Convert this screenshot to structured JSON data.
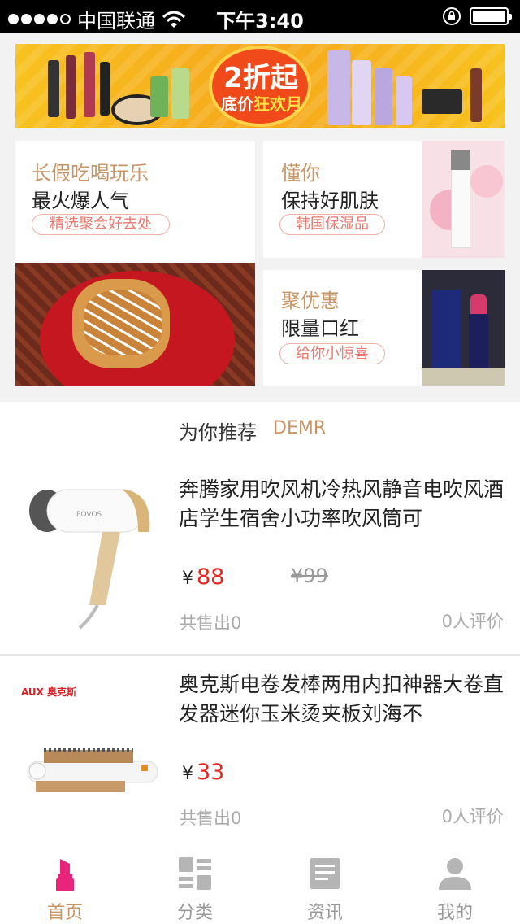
{
  "status_bar": {
    "carrier": "中国联通",
    "time": "下午3:40"
  },
  "banner": {
    "headline": "2折起",
    "sub_left": "底价",
    "sub_highlight": "狂欢月"
  },
  "promos": [
    {
      "title": "长假吃喝玩乐",
      "subtitle": "最火爆人气",
      "tag": "精选聚会好去处"
    },
    {
      "title": "懂你",
      "subtitle": "保持好肌肤",
      "tag": "韩国保湿品"
    },
    {
      "title": "聚优惠",
      "subtitle": "限量口红",
      "tag": "给你小惊喜"
    }
  ],
  "recommend": {
    "label": "为你推荐",
    "brand": "DEMR"
  },
  "products": [
    {
      "title": " 奔腾家用吹风机冷热风静音电吹风酒店学生宿舍小功率吹风筒可",
      "currency": "¥",
      "price": "88",
      "old_price": "¥99",
      "sold": "共售出0",
      "reviews": "0人评价",
      "image_brand": "POVOS"
    },
    {
      "title": " 奥克斯电卷发棒两用内扣神器大卷直发器迷你玉米烫夹板刘海不",
      "currency": "¥",
      "price": "33",
      "sold": "共售出0",
      "reviews": "0人评价",
      "image_brand": "AUX 奥克斯"
    }
  ],
  "tabs": [
    {
      "label": "首页",
      "icon": "lipstick-icon",
      "active": true
    },
    {
      "label": "分类",
      "icon": "category-grid-icon",
      "active": false
    },
    {
      "label": "资讯",
      "icon": "news-icon",
      "active": false
    },
    {
      "label": "我的",
      "icon": "user-icon",
      "active": false
    }
  ],
  "colors": {
    "accent": "#c69565",
    "price": "#e8261f",
    "tag": "#e87a6f",
    "active_tab_icon": "#e8257a"
  }
}
